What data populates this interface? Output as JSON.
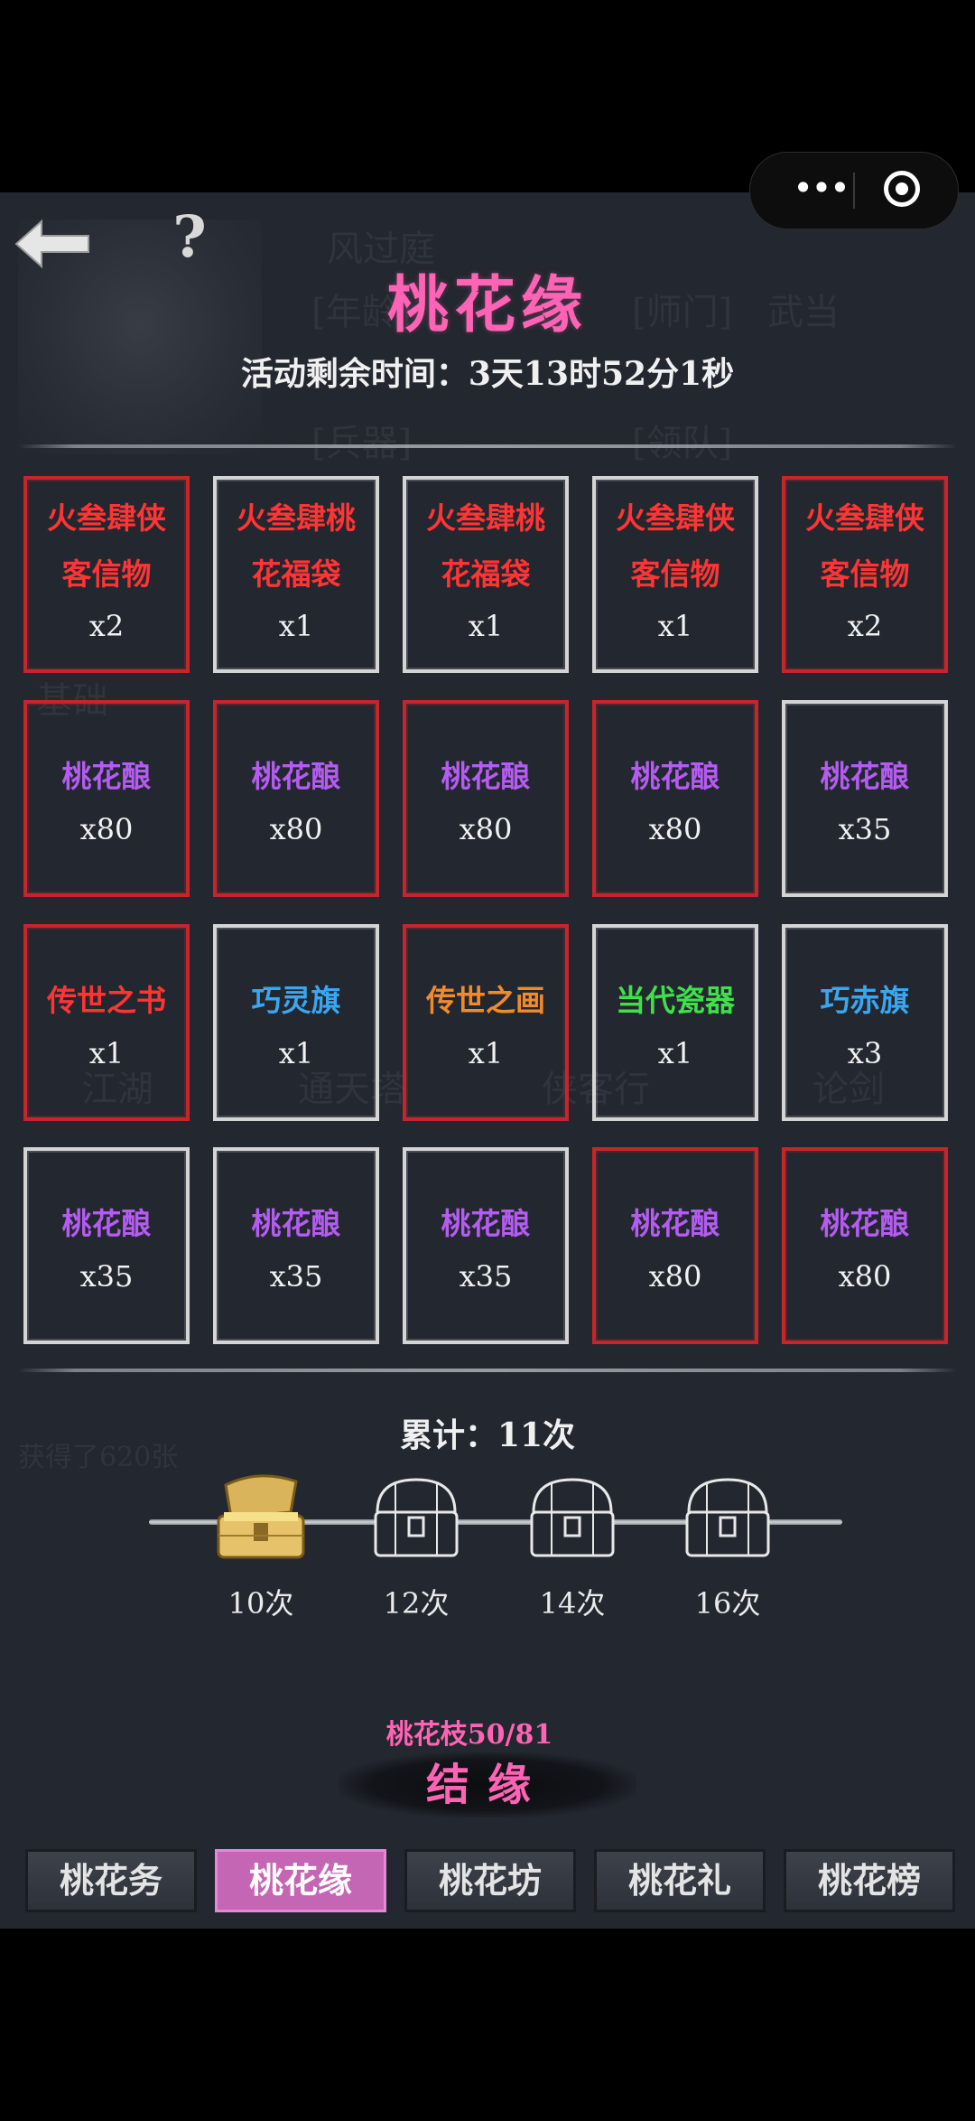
{
  "header": {
    "title": "桃花缘",
    "timer": "活动剩余时间：3天13时52分1秒",
    "back_icon": "back-arrow-icon",
    "help_label": "?"
  },
  "capsule": {
    "more": "•••",
    "close_icon": "record-close-icon"
  },
  "background_text": [
    "风过庭",
    "[年龄]",
    "[师门]",
    "武当",
    "[兵器]",
    "[领队]",
    "基础",
    "江湖",
    "通天塔",
    "侠客行",
    "论剑",
    "获得了620张"
  ],
  "grid": [
    [
      {
        "name_lines": [
          "火叁肆侠",
          "客信物"
        ],
        "qty": "x2",
        "color": "#ff3434",
        "frame": "red"
      },
      {
        "name_lines": [
          "火叁肆桃",
          "花福袋"
        ],
        "qty": "x1",
        "color": "#ff3434",
        "frame": "white"
      },
      {
        "name_lines": [
          "火叁肆桃",
          "花福袋"
        ],
        "qty": "x1",
        "color": "#ff3434",
        "frame": "white"
      },
      {
        "name_lines": [
          "火叁肆侠",
          "客信物"
        ],
        "qty": "x1",
        "color": "#ff3434",
        "frame": "white"
      },
      {
        "name_lines": [
          "火叁肆侠",
          "客信物"
        ],
        "qty": "x2",
        "color": "#ff3434",
        "frame": "red"
      }
    ],
    [
      {
        "name_lines": [
          "桃花酿"
        ],
        "qty": "x80",
        "color": "#b45cf0",
        "frame": "red"
      },
      {
        "name_lines": [
          "桃花酿"
        ],
        "qty": "x80",
        "color": "#b45cf0",
        "frame": "red"
      },
      {
        "name_lines": [
          "桃花酿"
        ],
        "qty": "x80",
        "color": "#b45cf0",
        "frame": "red"
      },
      {
        "name_lines": [
          "桃花酿"
        ],
        "qty": "x80",
        "color": "#b45cf0",
        "frame": "red"
      },
      {
        "name_lines": [
          "桃花酿"
        ],
        "qty": "x35",
        "color": "#b45cf0",
        "frame": "white"
      }
    ],
    [
      {
        "name_lines": [
          "传世之书"
        ],
        "qty": "x1",
        "color": "#ff3434",
        "frame": "red"
      },
      {
        "name_lines": [
          "巧灵旗"
        ],
        "qty": "x1",
        "color": "#3aa6f0",
        "frame": "white"
      },
      {
        "name_lines": [
          "传世之画"
        ],
        "qty": "x1",
        "color": "#f08a2c",
        "frame": "red"
      },
      {
        "name_lines": [
          "当代瓷器"
        ],
        "qty": "x1",
        "color": "#3fe04a",
        "frame": "white"
      },
      {
        "name_lines": [
          "巧赤旗"
        ],
        "qty": "x3",
        "color": "#3aa6f0",
        "frame": "white"
      }
    ],
    [
      {
        "name_lines": [
          "桃花酿"
        ],
        "qty": "x35",
        "color": "#b45cf0",
        "frame": "white"
      },
      {
        "name_lines": [
          "桃花酿"
        ],
        "qty": "x35",
        "color": "#b45cf0",
        "frame": "white"
      },
      {
        "name_lines": [
          "桃花酿"
        ],
        "qty": "x35",
        "color": "#b45cf0",
        "frame": "white"
      },
      {
        "name_lines": [
          "桃花酿"
        ],
        "qty": "x80",
        "color": "#b45cf0",
        "frame": "red"
      },
      {
        "name_lines": [
          "桃花酿"
        ],
        "qty": "x80",
        "color": "#b45cf0",
        "frame": "red"
      }
    ]
  ],
  "progress": {
    "total": "累计：11次",
    "milestones": [
      {
        "label": "10次",
        "state": "opened"
      },
      {
        "label": "12次",
        "state": "locked"
      },
      {
        "label": "14次",
        "state": "locked"
      },
      {
        "label": "16次",
        "state": "locked"
      }
    ]
  },
  "action": {
    "resource": "桃花枝50/81",
    "button": "结缘"
  },
  "tabs": [
    {
      "label": "桃花务",
      "active": false
    },
    {
      "label": "桃花缘",
      "active": true
    },
    {
      "label": "桃花坊",
      "active": false
    },
    {
      "label": "桃花礼",
      "active": false
    },
    {
      "label": "桃花榜",
      "active": false
    }
  ],
  "colors": {
    "accent": "#ff63b5",
    "tab_active": "#c566b5",
    "red_frame": "#c5262b",
    "white_frame": "#d4d4d4",
    "background": "#23272f"
  }
}
